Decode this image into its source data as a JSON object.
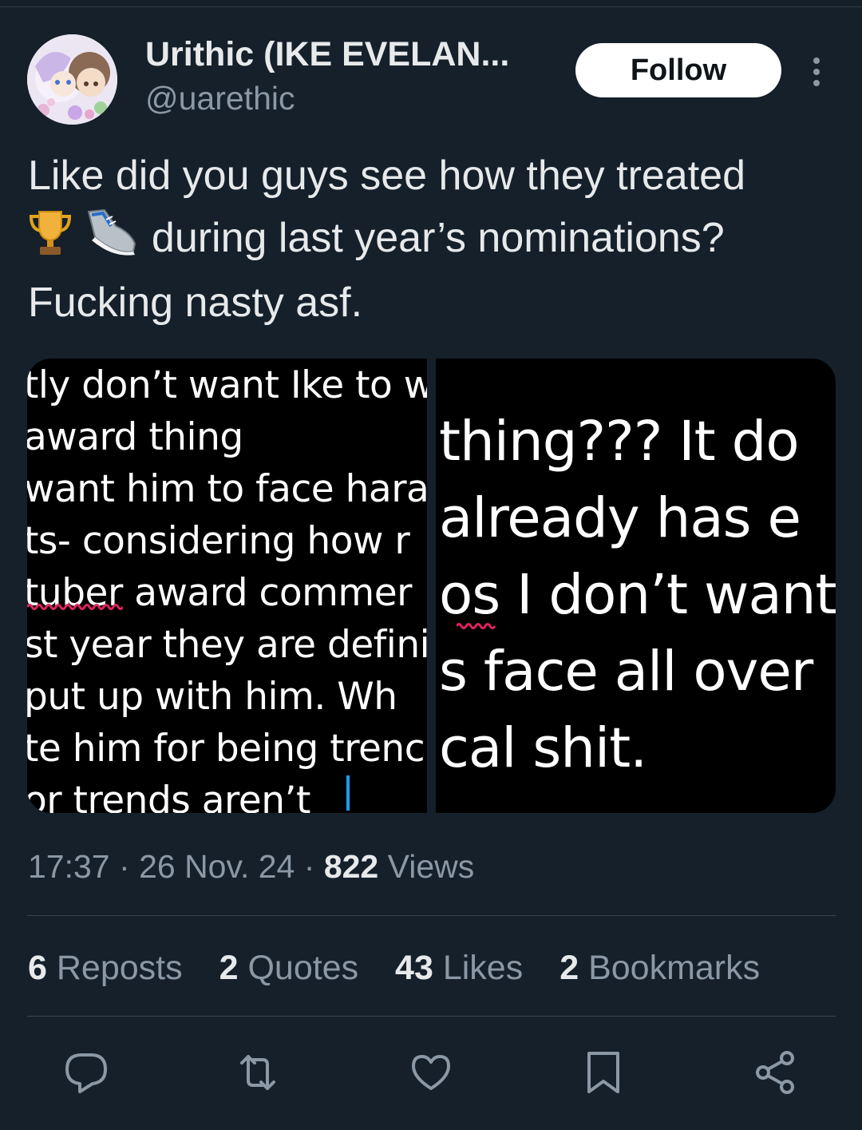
{
  "author": {
    "display_name": "Urithic (IKE EVELAN...",
    "handle": "@uarethic"
  },
  "follow_label": "Follow",
  "tweet": {
    "line1": "Like did you guys see how they treated",
    "line2_emojis": [
      "trophy-emoji",
      "sneaker-emoji"
    ],
    "line2_text": " during last year’s nominations?",
    "line3": "Fucking nasty asf."
  },
  "media": {
    "left_lines": [
      "tly don’t want Ike to w",
      "award thing",
      "want him to face hara",
      "ts- considering how r",
      "tuber award commer",
      "st year they are defini",
      "put up with him. Wh",
      "te him for being trenc",
      "or trends aren’t"
    ],
    "right_lines": [
      "thing??? It do",
      "already has e",
      "os I don’t want",
      "s face all over",
      "cal shit."
    ]
  },
  "meta": {
    "time": "17:37",
    "date": "26 Nov. 24",
    "views_count": "822",
    "views_label": "Views",
    "sep": "·"
  },
  "stats": {
    "reposts_count": "6",
    "reposts_label": "Reposts",
    "quotes_count": "2",
    "quotes_label": "Quotes",
    "likes_count": "43",
    "likes_label": "Likes",
    "bookmarks_count": "2",
    "bookmarks_label": "Bookmarks"
  },
  "colors": {
    "background": "#15202b",
    "text": "#e7e9ea",
    "muted": "#8b98a5",
    "accent": "#1d9bf0"
  },
  "action_icons": [
    "reply-icon",
    "repost-icon",
    "like-icon",
    "bookmark-icon",
    "share-icon"
  ]
}
